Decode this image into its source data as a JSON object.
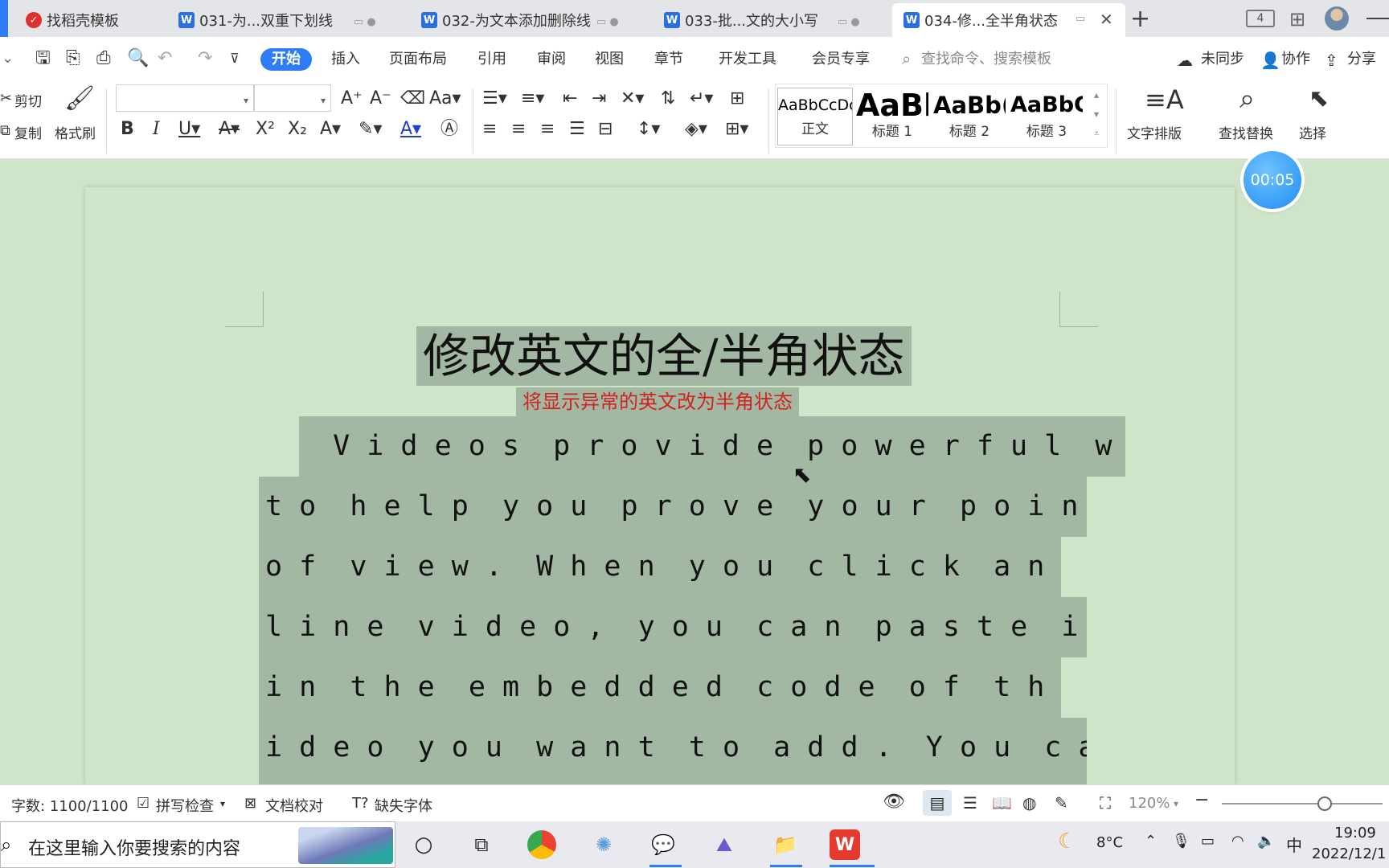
{
  "tabs": [
    {
      "label": "找稻壳模板",
      "icon": "docer-icon"
    },
    {
      "label": "031-为...双重下划线",
      "icon": "wps-writer-icon"
    },
    {
      "label": "032-为文本添加删除线",
      "icon": "wps-writer-icon"
    },
    {
      "label": "033-批...文的大小写",
      "icon": "wps-writer-icon"
    },
    {
      "label": "034-修...全半角状态",
      "icon": "wps-writer-icon",
      "active": true
    }
  ],
  "tabbar": {
    "new_tab": "+",
    "window_count": "4"
  },
  "menu": {
    "items": [
      "开始",
      "插入",
      "页面布局",
      "引用",
      "审阅",
      "视图",
      "章节",
      "开发工具",
      "会员专享"
    ],
    "search_placeholder": "查找命令、搜索模板",
    "sync": "未同步",
    "collab": "协作",
    "share": "分享"
  },
  "ribbon": {
    "cut": "剪切",
    "copy": "复制",
    "format_painter": "格式刷",
    "font_name": "",
    "font_size": "",
    "styles": [
      {
        "preview": "AaBbCcDc",
        "name": "正文"
      },
      {
        "preview": "AaBl",
        "name": "标题 1"
      },
      {
        "preview": "AaBb(",
        "name": "标题 2"
      },
      {
        "preview": "AaBbC",
        "name": "标题 3"
      }
    ],
    "text_layout": "文字排版",
    "find_replace": "查找替换",
    "select": "选择"
  },
  "document": {
    "title": "修改英文的全/半角状态",
    "subtitle": "将显示异常的英文改为半角状态",
    "body_lines": [
      "  V i d e o s  p r o v i d e  p o w e r f u l  w a y s",
      "t o  h e l p  y o u  p r o v e  y o u r  p o i n t",
      "o f  v i e w .  W h e n  y o u  c l i c k  a n  o n",
      "l i n e  v i d e o ,  y o u  c a n  p a s t e  i t",
      "i n  t h e  e m b e d d e d  c o d e  o f  t h e  v",
      "i d e o  y o u  w a n t  t o  a d d .  Y o u  c a n"
    ]
  },
  "timer": "00:05",
  "status": {
    "word_count": "字数: 1100/1100",
    "spell_check": "拼写检查",
    "proofread": "文档校对",
    "missing_fonts": "缺失字体",
    "zoom": "120%",
    "zoom_level": 0.64
  },
  "taskbar": {
    "search_placeholder": "在这里输入你要搜索的内容",
    "weather": "8°C",
    "ime": "中",
    "time": "19:09",
    "date": "2022/12/1"
  },
  "colors": {
    "accent": "#2e7cf6",
    "doc_bg": "#cfe5c9",
    "selection": "#a3b8a3",
    "subtitle": "#d0231f"
  }
}
